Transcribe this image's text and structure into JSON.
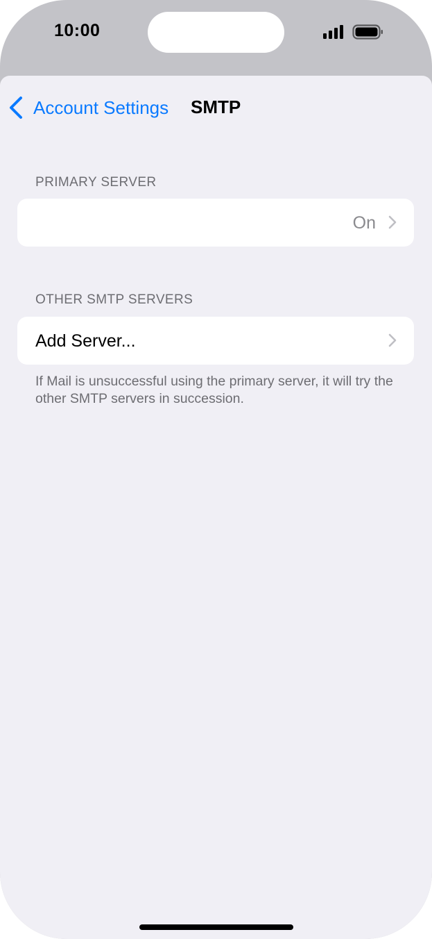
{
  "status_bar": {
    "time": "10:00",
    "signal_icon": "cellular-signal-icon",
    "battery_icon": "battery-full-icon"
  },
  "nav": {
    "back_label": "Account Settings",
    "back_icon": "chevron-left-icon",
    "title": "SMTP"
  },
  "primary_server": {
    "header": "PRIMARY SERVER",
    "row": {
      "label": "",
      "value": "On"
    }
  },
  "other_servers": {
    "header": "OTHER SMTP SERVERS",
    "add_label": "Add Server...",
    "footer": "If Mail is unsuccessful using the primary server, it will try the other SMTP servers in succession."
  },
  "colors": {
    "accent": "#0a7aff",
    "background": "#f0eff5",
    "secondary_text": "#6d6d72",
    "frame": "#c3c3c8"
  }
}
